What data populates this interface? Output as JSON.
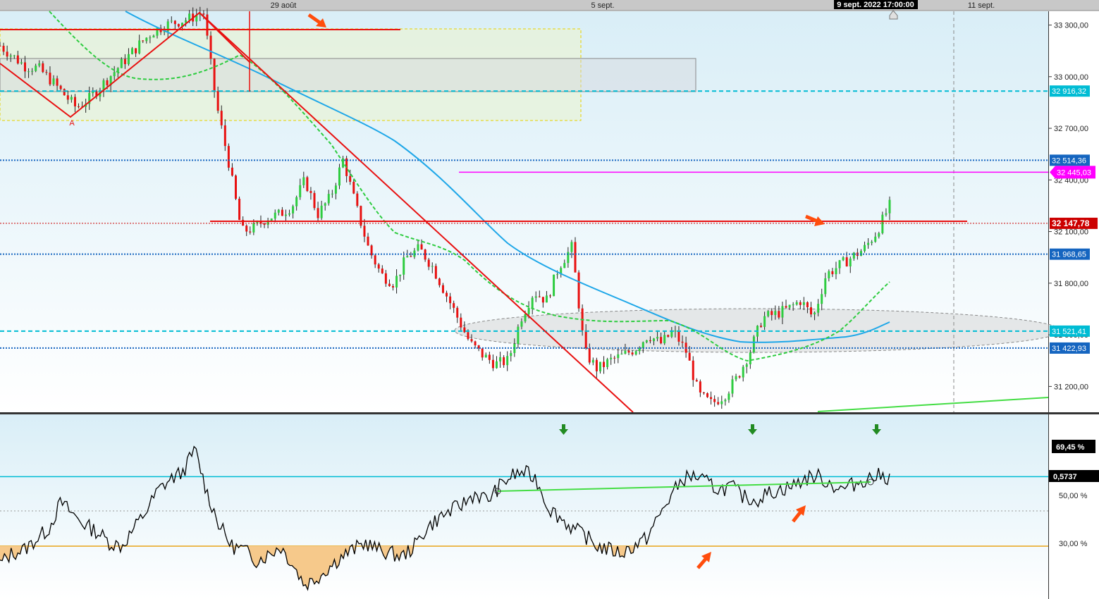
{
  "time_axis": {
    "labels": [
      "29 août",
      "5 sept.",
      "11 sept."
    ],
    "cursor_time": "9 sept. 2022 17:00:00"
  },
  "price_panel": {
    "y_ticks": [
      "33 300,00",
      "33 000,00",
      "32 700,00",
      "32 400,00",
      "32 100,00",
      "31 800,00",
      "31 500,00",
      "31 200,00"
    ],
    "pattern_label": "A",
    "level_badges": [
      {
        "text": "32 916,32",
        "bg": "#00bcd4",
        "fg": "#ffffff"
      },
      {
        "text": "32 514,36",
        "bg": "#1565c0",
        "fg": "#ffffff"
      },
      {
        "text": "32 445,03",
        "bg": "#ff00ff",
        "fg": "#ffffff"
      },
      {
        "text": "32 147,78",
        "bg": "#cc0000",
        "fg": "#ffffff"
      },
      {
        "text": "31 968,65",
        "bg": "#1565c0",
        "fg": "#ffffff"
      },
      {
        "text": "31 521,41",
        "bg": "#00bcd4",
        "fg": "#ffffff"
      },
      {
        "text": "31 422,93",
        "bg": "#1565c0",
        "fg": "#ffffff"
      }
    ]
  },
  "indicator_panel": {
    "labels": [
      "69,45 %",
      "0,5737",
      "50,00 %",
      "30,00 %"
    ]
  },
  "chart_data": {
    "type": "line",
    "panels": [
      {
        "name": "price",
        "ylim": [
          31050,
          33380
        ],
        "candles_close_path": [
          33180,
          33120,
          33060,
          33050,
          32980,
          32900,
          32820,
          32870,
          32950,
          33030,
          33110,
          33190,
          33260,
          33300,
          33320,
          33340,
          33380,
          32850,
          32500,
          32100,
          32120,
          32180,
          32200,
          32250,
          32400,
          32200,
          32300,
          32520,
          32250,
          32000,
          31850,
          31800,
          31950,
          32000,
          31900,
          31750,
          31600,
          31450,
          31380,
          31330,
          31350,
          31600,
          31750,
          31700,
          31900,
          32010,
          31400,
          31300,
          31350,
          31380,
          31420,
          31500,
          31450,
          31520,
          31400,
          31150,
          31100,
          31150,
          31250,
          31400,
          31600,
          31620,
          31650,
          31700,
          31600,
          31850,
          31900,
          31950,
          32000,
          32100,
          32250
        ],
        "levels": [
          {
            "value": 32916.32,
            "style": "dashed",
            "color": "#00bcd4"
          },
          {
            "value": 32514.36,
            "style": "dotted",
            "color": "#1565c0"
          },
          {
            "value": 32445.03,
            "style": "solid",
            "color": "#ff00ff"
          },
          {
            "value": 32147.78,
            "style": "solid",
            "color": "#cc0000"
          },
          {
            "value": 31968.65,
            "style": "dotted",
            "color": "#1565c0"
          },
          {
            "value": 31521.41,
            "style": "dashed",
            "color": "#00bcd4"
          },
          {
            "value": 31422.93,
            "style": "dotted",
            "color": "#1565c0"
          }
        ]
      },
      {
        "name": "oscillator",
        "ylim": [
          0,
          100
        ],
        "series": [
          {
            "values": [
              20,
              26,
              28,
              34,
              40,
              55,
              48,
              42,
              38,
              32,
              30,
              40,
              50,
              62,
              68,
              72,
              85,
              60,
              42,
              30,
              28,
              22,
              25,
              30,
              20,
              8,
              12,
              18,
              24,
              28,
              32,
              28,
              26,
              24,
              30,
              40,
              46,
              50,
              54,
              60,
              56,
              64,
              70,
              72,
              68,
              52,
              46,
              40,
              36,
              30,
              28,
              26,
              30,
              34,
              46,
              58,
              68,
              70,
              66,
              62,
              64,
              58,
              56,
              60,
              62,
              64,
              68,
              70,
              66,
              62,
              65,
              68,
              70,
              69
            ]
          }
        ],
        "reference_levels": [
          69.45,
          50.0,
          30.0
        ]
      }
    ]
  }
}
